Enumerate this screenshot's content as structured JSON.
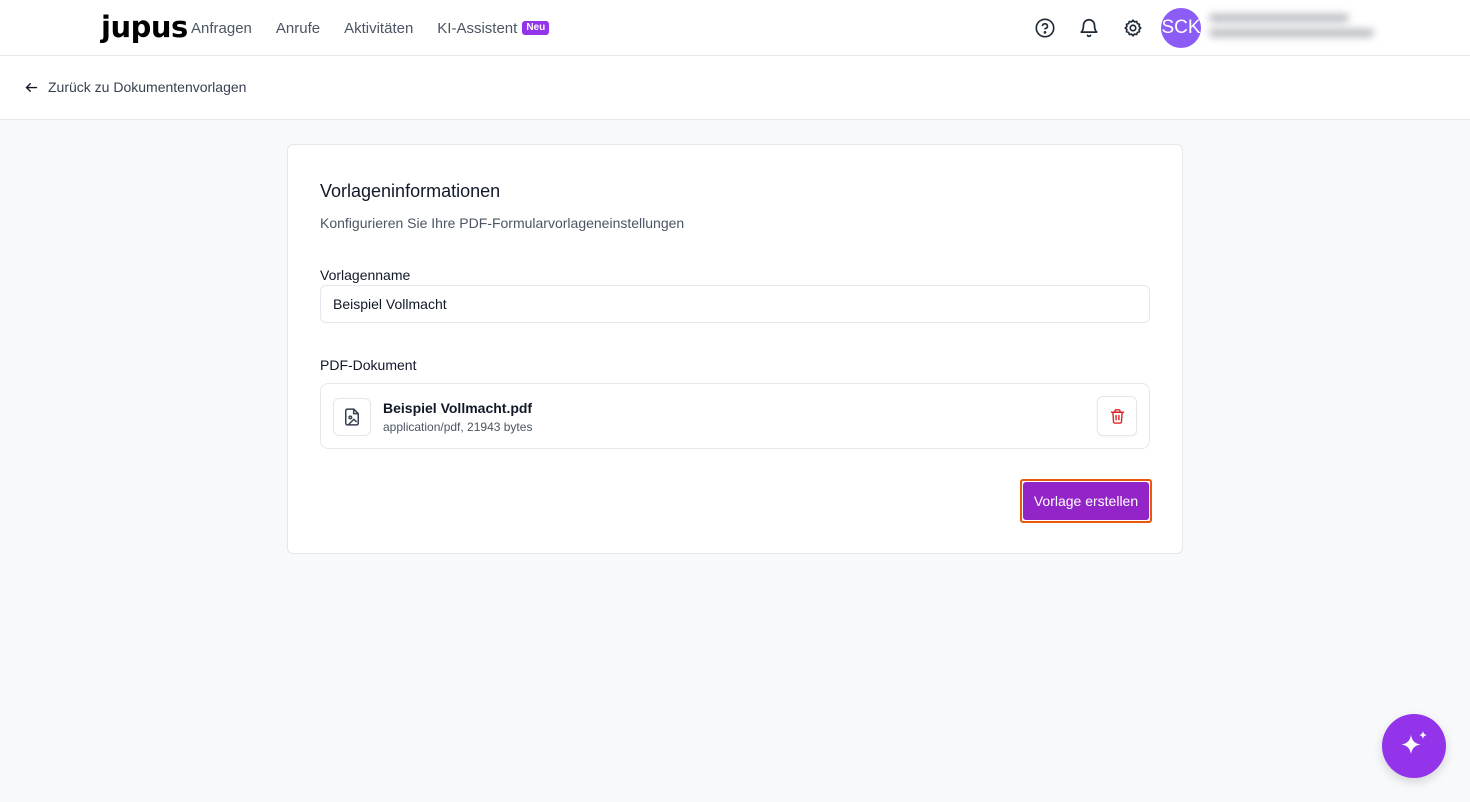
{
  "header": {
    "logo": "jupus",
    "nav": [
      {
        "label": "Anfragen"
      },
      {
        "label": "Anrufe"
      },
      {
        "label": "Aktivitäten"
      },
      {
        "label": "KI-Assistent",
        "badge": "Neu"
      }
    ],
    "icons": [
      "help-circle-icon",
      "bell-icon",
      "gear-icon"
    ],
    "avatar_initials": "SCK"
  },
  "back_link": {
    "label": "Zurück zu Dokumentenvorlagen"
  },
  "card": {
    "title": "Vorlageninformationen",
    "subtitle": "Konfigurieren Sie Ihre PDF-Formularvorlageneinstellungen",
    "name_label": "Vorlagenname",
    "name_value": "Beispiel Vollmacht",
    "pdf_label": "PDF-Dokument",
    "file": {
      "name": "Beispiel Vollmacht.pdf",
      "meta": "application/pdf, 21943 bytes"
    },
    "submit_label": "Vorlage erstellen"
  },
  "colors": {
    "accent": "#9324c8",
    "badge": "#9333ea",
    "avatar": "#8b5cf6",
    "danger": "#dc2626",
    "focus_outline": "#ea580c"
  }
}
